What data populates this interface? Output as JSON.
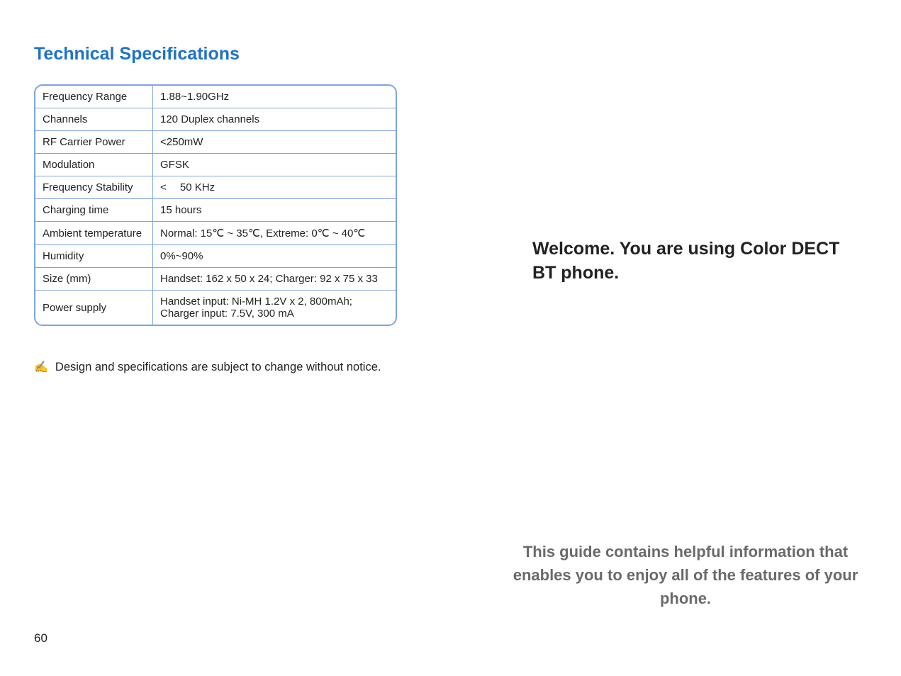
{
  "left": {
    "heading": "Technical Specifications",
    "specs": [
      {
        "label": "Frequency Range",
        "value": "1.88~1.90GHz"
      },
      {
        "label": "Channels",
        "value": "120 Duplex channels"
      },
      {
        "label": "RF Carrier Power",
        "value": "<250mW"
      },
      {
        "label": "Modulation",
        "value": "GFSK"
      },
      {
        "label": "Frequency Stability",
        "value": "<  50 KHz"
      },
      {
        "label": "Charging time",
        "value": "15 hours"
      },
      {
        "label": "Ambient temperature",
        "value": "Normal: 15℃ ~ 35℃, Extreme: 0℃ ~ 40℃"
      },
      {
        "label": "Humidity",
        "value": "0%~90%"
      },
      {
        "label": "Size (mm)",
        "value": "Handset: 162 x 50 x 24; Charger: 92 x 75 x 33"
      },
      {
        "label": "Power supply",
        "value": "Handset input: Ni-MH 1.2V x 2, 800mAh; Charger input: 7.5V, 300 mA"
      }
    ],
    "note_icon": "✍",
    "note_text": "Design and specifications are subject to change without notice.",
    "page_number": "60"
  },
  "right": {
    "welcome": "Welcome. You are using Color DECT BT phone.",
    "guide": "This guide contains helpful information that enables you to enjoy all of the features of your phone."
  }
}
